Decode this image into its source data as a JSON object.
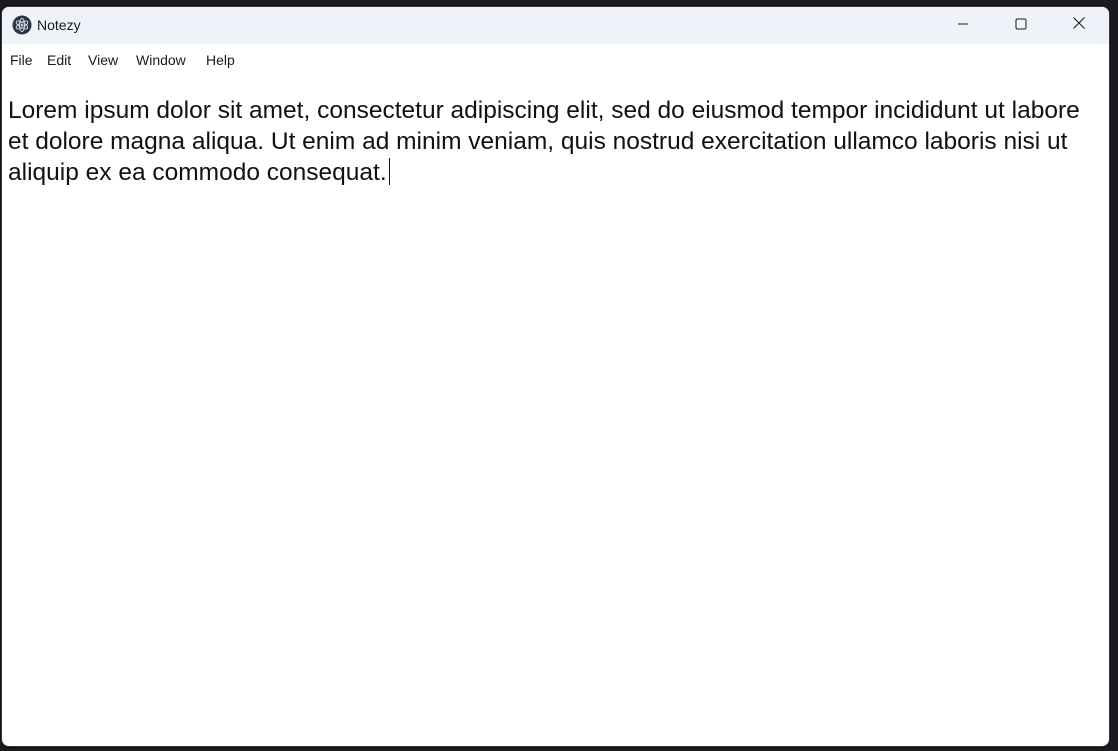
{
  "window": {
    "title": "Notezy",
    "icon": "app-logo-icon",
    "controls": {
      "minimize": "minimize-icon",
      "maximize": "maximize-icon",
      "close": "close-icon"
    }
  },
  "menu": {
    "items": [
      {
        "label": "File"
      },
      {
        "label": "Edit"
      },
      {
        "label": "View"
      },
      {
        "label": "Window"
      },
      {
        "label": "Help"
      }
    ]
  },
  "editor": {
    "content": "Lorem ipsum dolor sit amet, consectetur adipiscing elit, sed do eiusmod tempor incididunt ut labore et dolore magna aliqua. Ut enim ad minim veniam, quis nostrud exercitation ullamco laboris nisi ut aliquip ex ea commodo consequat."
  },
  "colors": {
    "titlebar_bg": "#eff3f9",
    "editor_bg": "#ffffff",
    "close_hover": "#c42b1c"
  }
}
